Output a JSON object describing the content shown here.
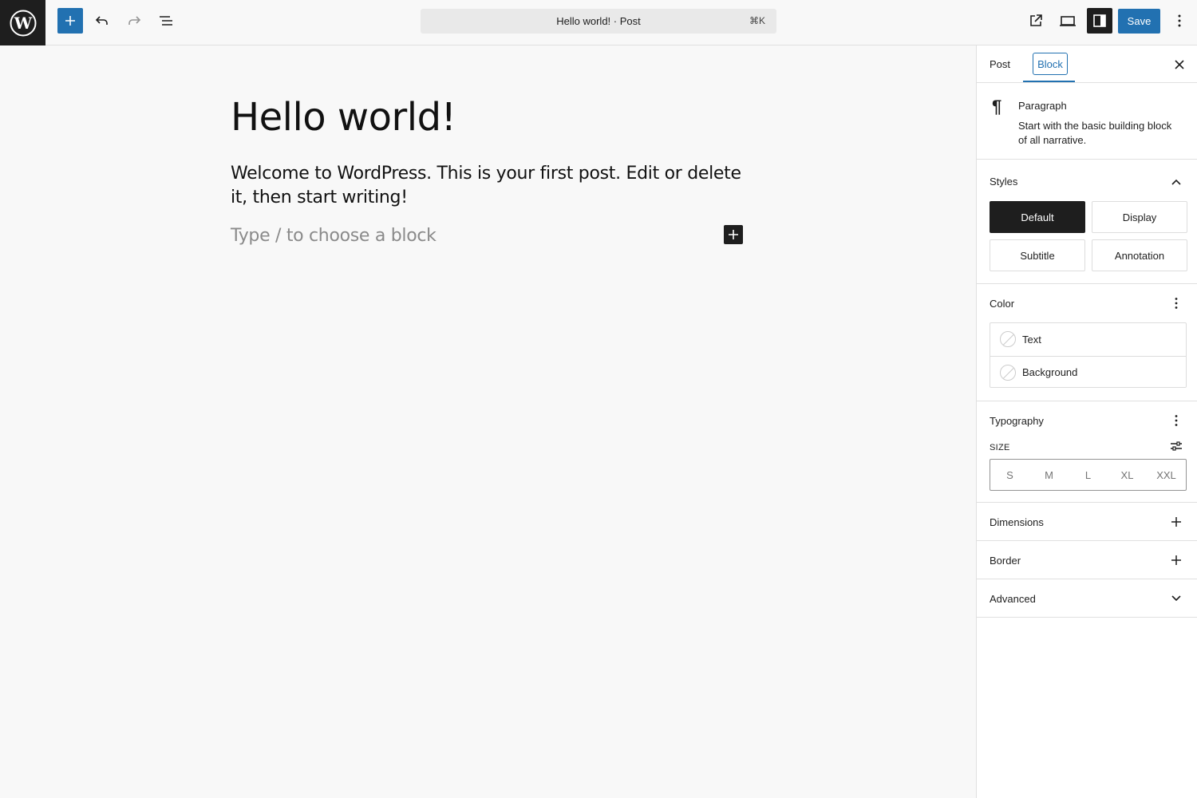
{
  "topbar": {
    "document_title": "Hello world! · Post",
    "command_shortcut": "⌘K",
    "save_label": "Save",
    "accent_color": "#2271b1"
  },
  "editor": {
    "post_title": "Hello world!",
    "paragraph": "Welcome to WordPress. This is your first post. Edit or delete it, then start writing!",
    "placeholder": "Type / to choose a block"
  },
  "sidebar": {
    "tabs": [
      {
        "label": "Post"
      },
      {
        "label": "Block"
      }
    ],
    "block_card": {
      "icon": "paragraph-icon",
      "title": "Paragraph",
      "description": "Start with the basic building block of all narrative."
    },
    "styles": {
      "title": "Styles",
      "options": [
        {
          "label": "Default",
          "active": true
        },
        {
          "label": "Display"
        },
        {
          "label": "Subtitle"
        },
        {
          "label": "Annotation"
        }
      ]
    },
    "color": {
      "title": "Color",
      "items": [
        {
          "label": "Text"
        },
        {
          "label": "Background"
        }
      ]
    },
    "typography": {
      "title": "Typography",
      "size_label": "SIZE",
      "sizes": [
        "S",
        "M",
        "L",
        "XL",
        "XXL"
      ]
    },
    "dimensions": {
      "title": "Dimensions"
    },
    "border": {
      "title": "Border"
    },
    "advanced": {
      "title": "Advanced"
    }
  }
}
